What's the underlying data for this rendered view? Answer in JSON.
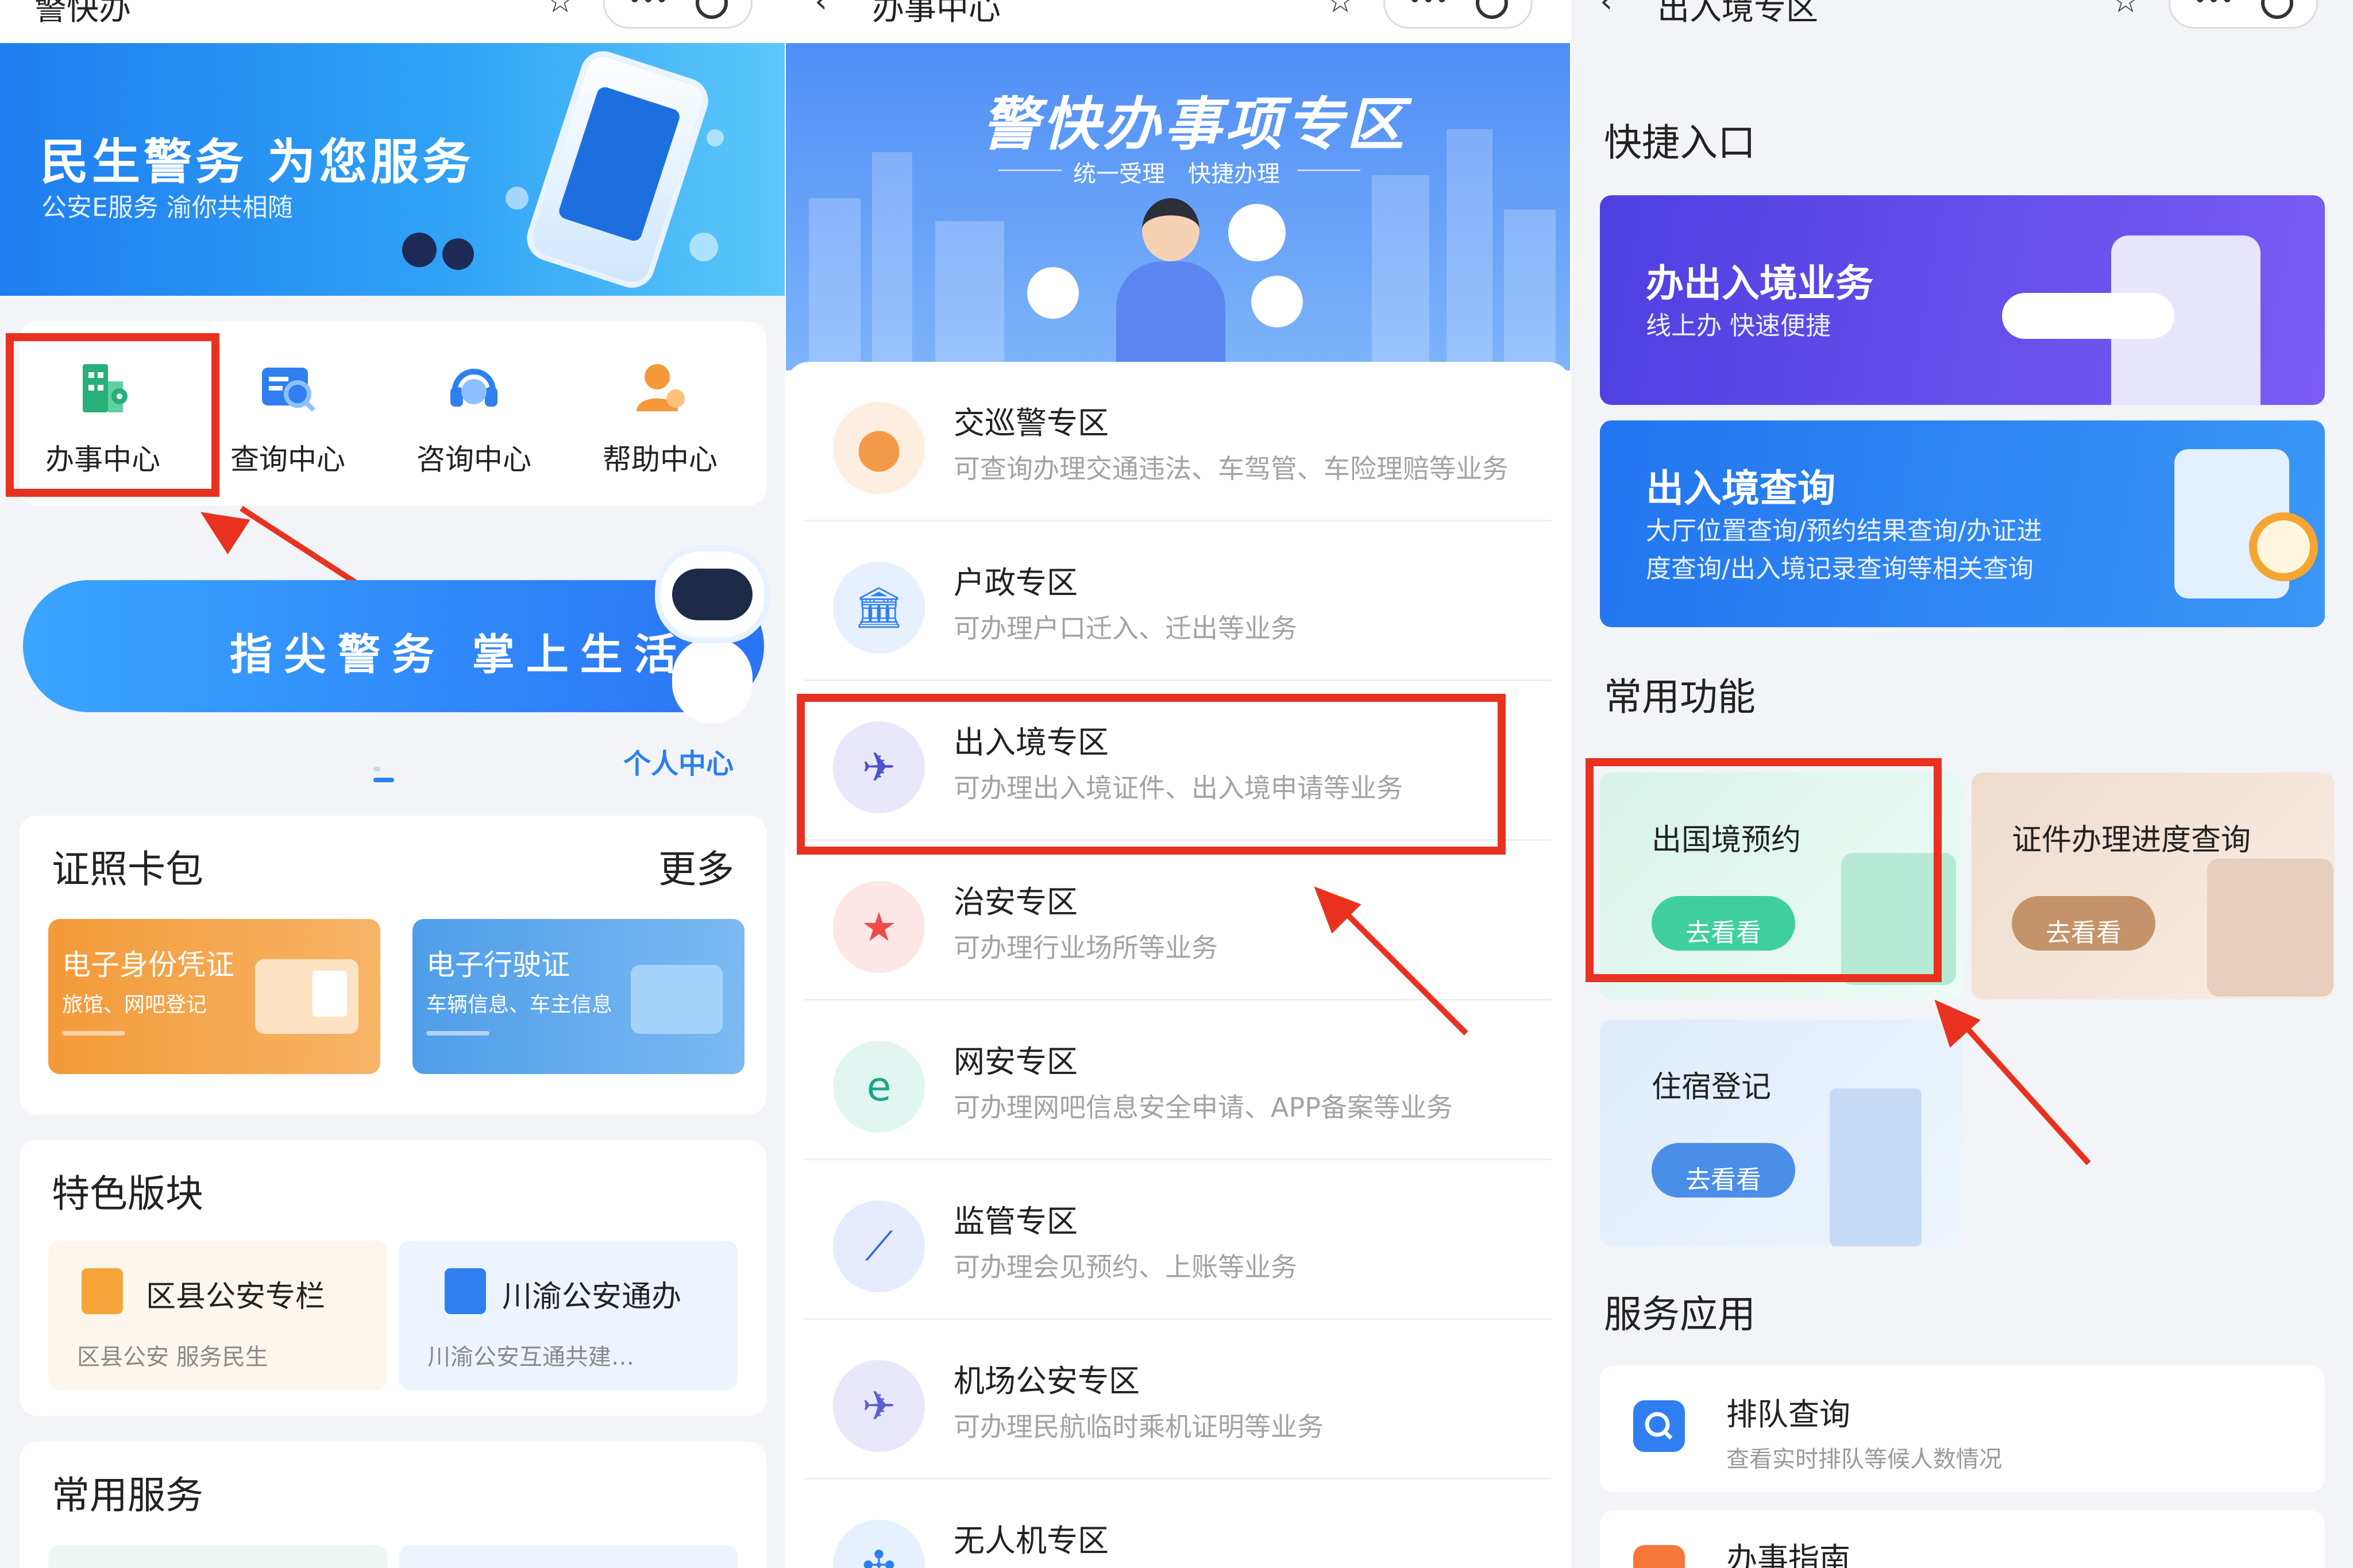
{
  "panel1": {
    "title": "警快办",
    "banner_title": "民生警务 为您服务",
    "banner_subtitle": "公安E服务 渝你共相随",
    "quick_items": [
      {
        "label": "办事中心",
        "icon": "building-location-icon",
        "color": "#27b07a"
      },
      {
        "label": "查询中心",
        "icon": "search-card-icon",
        "color": "#2f7ff0"
      },
      {
        "label": "咨询中心",
        "icon": "headset-icon",
        "color": "#2f7ff0"
      },
      {
        "label": "帮助中心",
        "icon": "person-help-icon",
        "color": "#f5983a"
      }
    ],
    "promo_text": "指尖警务 掌上生活",
    "promo_label": "个人中心",
    "card_wallet": {
      "title": "证照卡包",
      "more": "更多",
      "cards": [
        {
          "title": "电子身份凭证",
          "subtitle": "旅馆、网吧登记",
          "color": "#f49b3b"
        },
        {
          "title": "电子行驶证",
          "subtitle": "车辆信息、车主信息",
          "color": "#5aa7ea"
        }
      ]
    },
    "featured": {
      "title": "特色版块",
      "items": [
        {
          "title": "区县公安专栏",
          "subtitle": "区县公安 服务民生",
          "icon": "document-badge-icon"
        },
        {
          "title": "川渝公安通办",
          "subtitle": "川渝公安互通共建…",
          "icon": "overlap-squares-icon"
        }
      ]
    },
    "common_services_title": "常用服务"
  },
  "panel2": {
    "title": "办事中心",
    "banner_title": "警快办事项专区",
    "banner_subtitle": "统一受理　快捷办理",
    "items": [
      {
        "title": "交巡警专区",
        "subtitle": "可查询办理交通违法、车驾管、车险理赔等业务",
        "icon": "traffic-light-icon",
        "color": "#fdeee0",
        "icon_color": "#f39a4a"
      },
      {
        "title": "户政专区",
        "subtitle": "可办理户口迁入、迁出等业务",
        "icon": "government-building-icon",
        "color": "#e6f0ff",
        "icon_color": "#2f7ff0"
      },
      {
        "title": "出入境专区",
        "subtitle": "可办理出入境证件、出入境申请等业务",
        "icon": "globe-plane-icon",
        "color": "#e9e8fb",
        "icon_color": "#4d52c8"
      },
      {
        "title": "治安专区",
        "subtitle": "可办理行业场所等业务",
        "icon": "shield-star-icon",
        "color": "#fde6e6",
        "icon_color": "#ef4a4a"
      },
      {
        "title": "网安专区",
        "subtitle": "可办理网吧信息安全申请、APP备案等业务",
        "icon": "internet-e-icon",
        "color": "#e2f6f1",
        "icon_color": "#1aa88a"
      },
      {
        "title": "监管专区",
        "subtitle": "可办理会见预约、上账等业务",
        "icon": "trend-chart-icon",
        "color": "#e6ecfd",
        "icon_color": "#3567e6"
      },
      {
        "title": "机场公安专区",
        "subtitle": "可办理民航临时乘机证明等业务",
        "icon": "airplane-icon",
        "color": "#e9e8fb",
        "icon_color": "#5b5fd6"
      },
      {
        "title": "无人机专区",
        "subtitle": "",
        "icon": "drone-icon",
        "color": "#e6f0ff",
        "icon_color": "#2f7ff0"
      }
    ]
  },
  "panel3": {
    "title": "出入境专区",
    "quick_entry_title": "快捷入口",
    "quick_entries": [
      {
        "title": "办出入境业务",
        "subtitle": "线上办 快速便捷",
        "color": "#5b4ee8"
      },
      {
        "title": "出入境查询",
        "subtitle_line1": "大厅位置查询/预约结果查询/办证进",
        "subtitle_line2": "度查询/出入境记录查询等相关查询",
        "color": "#2f7ff0"
      }
    ],
    "common_title": "常用功能",
    "tiles": [
      {
        "title": "出国境预约",
        "button": "去看看",
        "bg": "#e3f6ef",
        "btn": "#3fcf9f"
      },
      {
        "title": "证件办理进度查询",
        "button": "去看看",
        "bg": "#f3e6dc",
        "btn": "#c5936a"
      },
      {
        "title": "住宿登记",
        "button": "去看看",
        "bg": "#e6f0fc",
        "btn": "#4a8ee8"
      }
    ],
    "services_title": "服务应用",
    "services": [
      {
        "title": "排队查询",
        "subtitle": "查看实时排队等候人数情况",
        "icon": "search-icon",
        "color": "#2f7ff0"
      },
      {
        "title": "办事指南",
        "subtitle": "",
        "icon": "flag-icon",
        "color": "#f5783a"
      }
    ]
  },
  "highlight_color": "#e8321f"
}
